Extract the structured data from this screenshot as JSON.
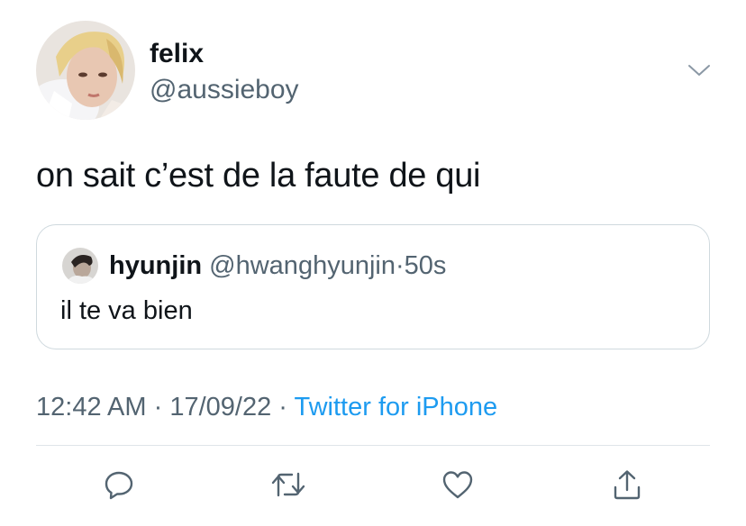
{
  "author": {
    "display_name": "felix",
    "handle": "@aussieboy"
  },
  "tweet": {
    "text": "on sait c’est de la faute de qui"
  },
  "quoted_tweet": {
    "display_name": "hyunjin",
    "handle": "@hwanghyunjin",
    "separator": "·",
    "time": "50s",
    "text": "il te va bien"
  },
  "meta": {
    "time": "12:42 AM",
    "separator": "·",
    "date": "17/09/22",
    "source": "Twitter for iPhone"
  },
  "actions": [
    {
      "icon": "reply-icon"
    },
    {
      "icon": "retweet-icon"
    },
    {
      "icon": "like-icon"
    },
    {
      "icon": "share-icon"
    }
  ],
  "colors": {
    "text": "#0f1419",
    "secondary": "#536471",
    "link": "#1d9bf0",
    "border": "#cfd9de"
  }
}
